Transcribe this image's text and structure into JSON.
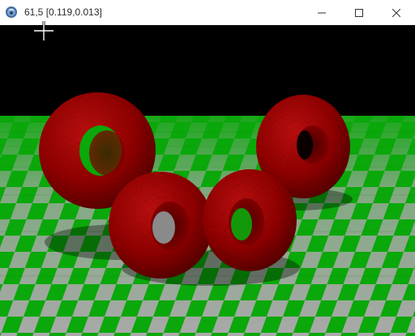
{
  "window": {
    "title": "61,5 [0.119,0.013]",
    "icon": "app-sphere-icon",
    "controls": {
      "minimize_icon": "minimize-icon",
      "maximize_icon": "maximize-icon",
      "close_icon": "close-icon"
    }
  },
  "scene": {
    "background_color": "#000000",
    "floor": {
      "pattern": "checkerboard",
      "color_a": "#0aa80a",
      "color_b": "#a9a9a9"
    },
    "objects": [
      {
        "type": "torus",
        "color": "#b00000"
      },
      {
        "type": "torus",
        "color": "#b00000"
      },
      {
        "type": "torus",
        "color": "#b00000"
      },
      {
        "type": "torus",
        "color": "#b00000"
      }
    ]
  },
  "cursor": {
    "icon": "crosshair-cursor-icon"
  }
}
